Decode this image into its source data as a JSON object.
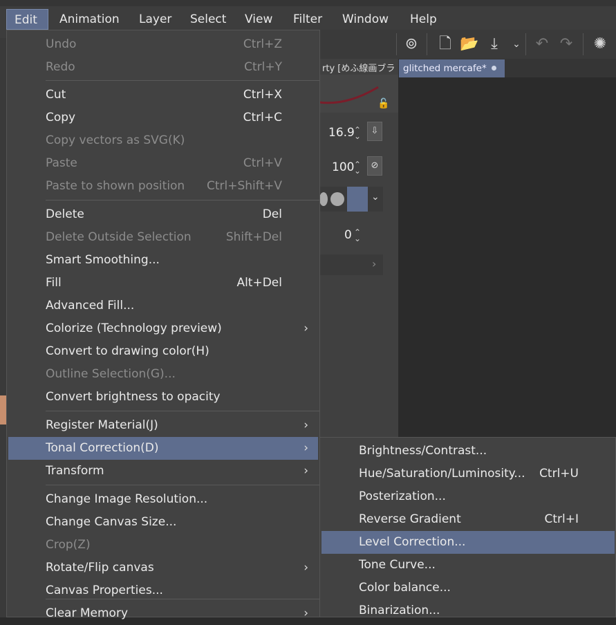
{
  "menubar": {
    "items": [
      "Edit",
      "Animation",
      "Layer",
      "Select",
      "View",
      "Filter",
      "Window",
      "Help"
    ]
  },
  "edit_menu": {
    "items": [
      {
        "label": "Undo",
        "shortcut": "Ctrl+Z",
        "disabled": true
      },
      {
        "label": "Redo",
        "shortcut": "Ctrl+Y",
        "disabled": true
      },
      {
        "label": "Cut",
        "shortcut": "Ctrl+X",
        "disabled": false
      },
      {
        "label": "Copy",
        "shortcut": "Ctrl+C",
        "disabled": false
      },
      {
        "label": "Copy vectors as SVG(K)",
        "shortcut": "",
        "disabled": true
      },
      {
        "label": "Paste",
        "shortcut": "Ctrl+V",
        "disabled": true
      },
      {
        "label": "Paste to shown position",
        "shortcut": "Ctrl+Shift+V",
        "disabled": true
      },
      {
        "label": "Delete",
        "shortcut": "Del",
        "disabled": false
      },
      {
        "label": "Delete Outside Selection",
        "shortcut": "Shift+Del",
        "disabled": true
      },
      {
        "label": "Smart Smoothing...",
        "shortcut": "",
        "disabled": false
      },
      {
        "label": "Fill",
        "shortcut": "Alt+Del",
        "disabled": false
      },
      {
        "label": "Advanced Fill...",
        "shortcut": "",
        "disabled": false
      },
      {
        "label": "Colorize (Technology preview)",
        "shortcut": "",
        "disabled": false,
        "submenu": true
      },
      {
        "label": "Convert to drawing color(H)",
        "shortcut": "",
        "disabled": false
      },
      {
        "label": "Outline Selection(G)...",
        "shortcut": "",
        "disabled": true
      },
      {
        "label": "Convert brightness to opacity",
        "shortcut": "",
        "disabled": false
      },
      {
        "label": "Register Material(J)",
        "shortcut": "",
        "disabled": false,
        "submenu": true
      },
      {
        "label": "Tonal Correction(D)",
        "shortcut": "",
        "disabled": false,
        "submenu": true,
        "highlighted": true
      },
      {
        "label": "Transform",
        "shortcut": "",
        "disabled": false,
        "submenu": true
      },
      {
        "label": "Change Image Resolution...",
        "shortcut": "",
        "disabled": false
      },
      {
        "label": "Change Canvas Size...",
        "shortcut": "",
        "disabled": false
      },
      {
        "label": "Crop(Z)",
        "shortcut": "",
        "disabled": true
      },
      {
        "label": "Rotate/Flip canvas",
        "shortcut": "",
        "disabled": false,
        "submenu": true
      },
      {
        "label": "Canvas Properties...",
        "shortcut": "",
        "disabled": false
      },
      {
        "label": "Clear Memory",
        "shortcut": "",
        "disabled": false,
        "submenu": true
      }
    ]
  },
  "tonal_submenu": {
    "items": [
      {
        "label": "Brightness/Contrast...",
        "shortcut": ""
      },
      {
        "label": "Hue/Saturation/Luminosity...",
        "shortcut": "Ctrl+U"
      },
      {
        "label": "Posterization...",
        "shortcut": ""
      },
      {
        "label": "Reverse Gradient",
        "shortcut": "Ctrl+I"
      },
      {
        "label": "Level Correction...",
        "shortcut": "",
        "highlighted": true
      },
      {
        "label": "Tone Curve...",
        "shortcut": ""
      },
      {
        "label": "Color balance...",
        "shortcut": ""
      },
      {
        "label": "Binarization...",
        "shortcut": ""
      }
    ]
  },
  "document": {
    "tab_title": "glitched mercafe*"
  },
  "tool_panel": {
    "header_text": "rty [めふ線画ブラ",
    "brush_size": "16.9",
    "opacity": "100",
    "value3": "0"
  },
  "colors": {
    "accent": "#5e6d8e",
    "menu_bg": "#424242",
    "menubar_bg": "#3d3d3d",
    "disabled_text": "#8c8c8c",
    "swatch": "#c88f6e"
  }
}
